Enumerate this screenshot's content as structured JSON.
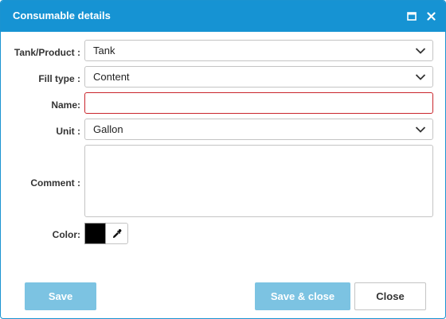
{
  "dialog": {
    "title": "Consumable details"
  },
  "icons": {
    "maximize": "maximize-icon",
    "close": "close-icon",
    "dropdown": "chevron-down-icon",
    "eyedropper": "eyedropper-icon"
  },
  "form": {
    "tank_product": {
      "label": "Tank/Product :",
      "value": "Tank"
    },
    "fill_type": {
      "label": "Fill type :",
      "value": "Content"
    },
    "name": {
      "label": "Name:",
      "value": ""
    },
    "unit": {
      "label": "Unit :",
      "value": "Gallon"
    },
    "comment": {
      "label": "Comment :",
      "value": ""
    },
    "color": {
      "label": "Color:",
      "value": "#000000"
    }
  },
  "buttons": {
    "save": "Save",
    "save_close": "Save & close",
    "close": "Close"
  },
  "colors": {
    "titlebar": "#1693d3",
    "primary_button": "#7cc3e2",
    "error_border": "#c9252c"
  }
}
